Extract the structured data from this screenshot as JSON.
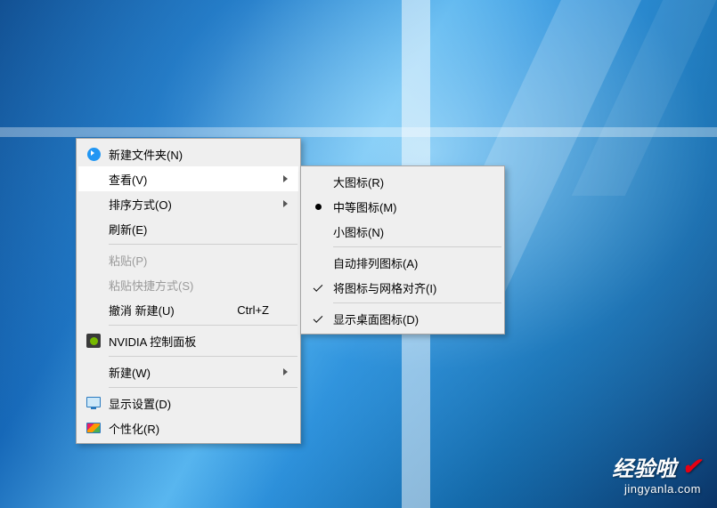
{
  "main_menu": {
    "new_folder": "新建文件夹(N)",
    "view": "查看(V)",
    "sort": "排序方式(O)",
    "refresh": "刷新(E)",
    "paste": "粘贴(P)",
    "paste_shortcut": "粘贴快捷方式(S)",
    "undo": "撤消 新建(U)",
    "undo_shortcut": "Ctrl+Z",
    "nvidia": "NVIDIA 控制面板",
    "new": "新建(W)",
    "display_settings": "显示设置(D)",
    "personalize": "个性化(R)"
  },
  "view_submenu": {
    "large_icons": "大图标(R)",
    "medium_icons": "中等图标(M)",
    "small_icons": "小图标(N)",
    "auto_arrange": "自动排列图标(A)",
    "align_grid": "将图标与网格对齐(I)",
    "show_icons": "显示桌面图标(D)"
  },
  "watermark": {
    "title": "经验啦",
    "url": "jingyanla.com"
  }
}
